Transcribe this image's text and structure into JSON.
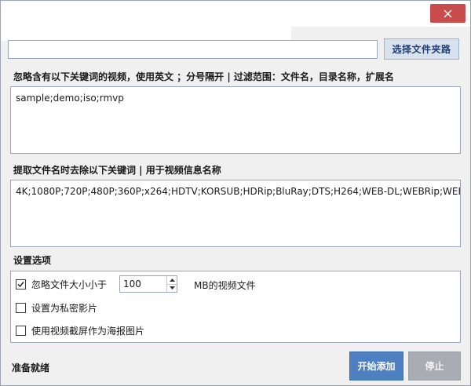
{
  "window": {
    "close_icon": "close-icon"
  },
  "path": {
    "value": "",
    "browse_label": "选择文件夹路"
  },
  "ignore_keywords": {
    "label": "忽略含有以下关键词的视频，使用英文 ；分号隔开 | 过滤范围：文件名，目录名称，扩展名",
    "value": "sample;demo;iso;rmvp"
  },
  "strip_keywords": {
    "label": "提取文件名时去除以下关键词 | 用于视频信息名称",
    "value": "4K;1080P;720P;480P;360P;x264;HDTV;KORSUB;HDRip;BluRay;DTS;H264;WEB-DL;WEBRip;WEB"
  },
  "settings": {
    "label": "设置选项",
    "ignore_small": {
      "label": "忽略文件大小小于",
      "checked": true,
      "value": "100",
      "unit": "MB的视频文件"
    },
    "private": {
      "label": "设置为私密影片",
      "checked": false
    },
    "poster": {
      "label": "使用视频截屏作为海报图片",
      "checked": false
    }
  },
  "status": "准备就绪",
  "actions": {
    "start": "开始添加",
    "stop": "停止"
  },
  "colors": {
    "close": "#c74c4b",
    "primary": "#4d7fc1",
    "disabled": "#a9adb3"
  }
}
